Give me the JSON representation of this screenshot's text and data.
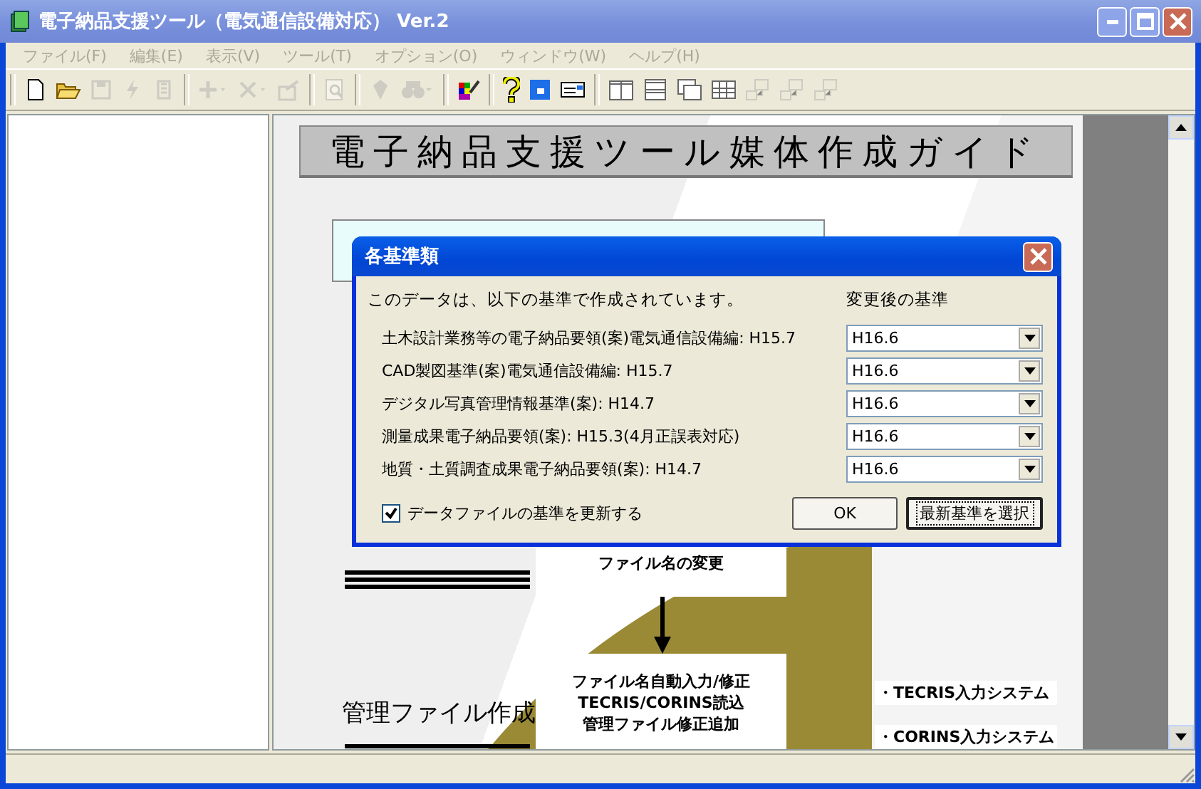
{
  "window": {
    "title": "電子納品支援ツール（電気通信設備対応） Ver.2"
  },
  "menu": [
    {
      "label": "ファイル(F)",
      "disabled": true
    },
    {
      "label": "編集(E)",
      "disabled": true
    },
    {
      "label": "表示(V)",
      "disabled": true
    },
    {
      "label": "ツール(T)",
      "disabled": true
    },
    {
      "label": "オプション(O)",
      "disabled": true
    },
    {
      "label": "ウィンドウ(W)",
      "disabled": true
    },
    {
      "label": "ヘルプ(H)",
      "disabled": true
    }
  ],
  "toolbar": [
    {
      "buttons": [
        {
          "kind": "new",
          "disabled": false
        },
        {
          "kind": "open",
          "disabled": false
        },
        {
          "kind": "save",
          "disabled": true
        },
        {
          "kind": "lightning",
          "disabled": true
        },
        {
          "kind": "stack",
          "disabled": true
        }
      ]
    },
    {
      "buttons": [
        {
          "kind": "plus",
          "disabled": true
        },
        {
          "kind": "cross",
          "disabled": true
        },
        {
          "kind": "export",
          "disabled": true
        }
      ]
    },
    {
      "buttons": [
        {
          "kind": "preview",
          "disabled": true
        }
      ]
    },
    {
      "buttons": [
        {
          "kind": "gem",
          "disabled": true
        },
        {
          "kind": "binoculars",
          "disabled": true
        }
      ]
    },
    {
      "buttons": [
        {
          "kind": "palette",
          "disabled": false
        }
      ]
    },
    {
      "buttons": [
        {
          "kind": "help",
          "disabled": false
        },
        {
          "kind": "window",
          "disabled": false
        },
        {
          "kind": "card",
          "disabled": false
        }
      ]
    },
    {
      "buttons": [
        {
          "kind": "split-v",
          "disabled": false
        },
        {
          "kind": "split-h",
          "disabled": false
        },
        {
          "kind": "cascade",
          "disabled": false
        },
        {
          "kind": "grid",
          "disabled": false
        },
        {
          "kind": "network",
          "disabled": true
        },
        {
          "kind": "network",
          "disabled": true
        },
        {
          "kind": "network",
          "disabled": true
        }
      ]
    }
  ],
  "document": {
    "banner": "電子納品支援ツール媒体作成ガイド",
    "step_box": "ファイル名の変更",
    "auto_box": [
      "ファイル名自動入力/修正",
      "TECRIS/CORINS読込",
      "管理ファイル修正追加"
    ],
    "section_heading": "管理ファイル作成",
    "systems": [
      "・TECRIS入力システム",
      "・CORINS入力システム"
    ]
  },
  "dialog": {
    "title": "各基準類",
    "intro": "このデータは、以下の基準で作成されています。",
    "column_heading": "変更後の基準",
    "rows": [
      {
        "label": "土木設計業務等の電子納品要領(案)電気通信設備編: H15.7",
        "value": "H16.6"
      },
      {
        "label": "CAD製図基準(案)電気通信設備編: H15.7",
        "value": "H16.6"
      },
      {
        "label": "デジタル写真管理情報基準(案): H14.7",
        "value": "H16.6"
      },
      {
        "label": "測量成果電子納品要領(案): H15.3(4月正誤表対応)",
        "value": "H16.6"
      },
      {
        "label": "地質・土質調査成果電子納品要領(案): H14.7",
        "value": "H16.6"
      }
    ],
    "checkbox": {
      "label": "データファイルの基準を更新する",
      "checked": true
    },
    "buttons": [
      {
        "label": "OK",
        "focused": false
      },
      {
        "label": "最新基準を選択",
        "focused": true
      }
    ]
  }
}
